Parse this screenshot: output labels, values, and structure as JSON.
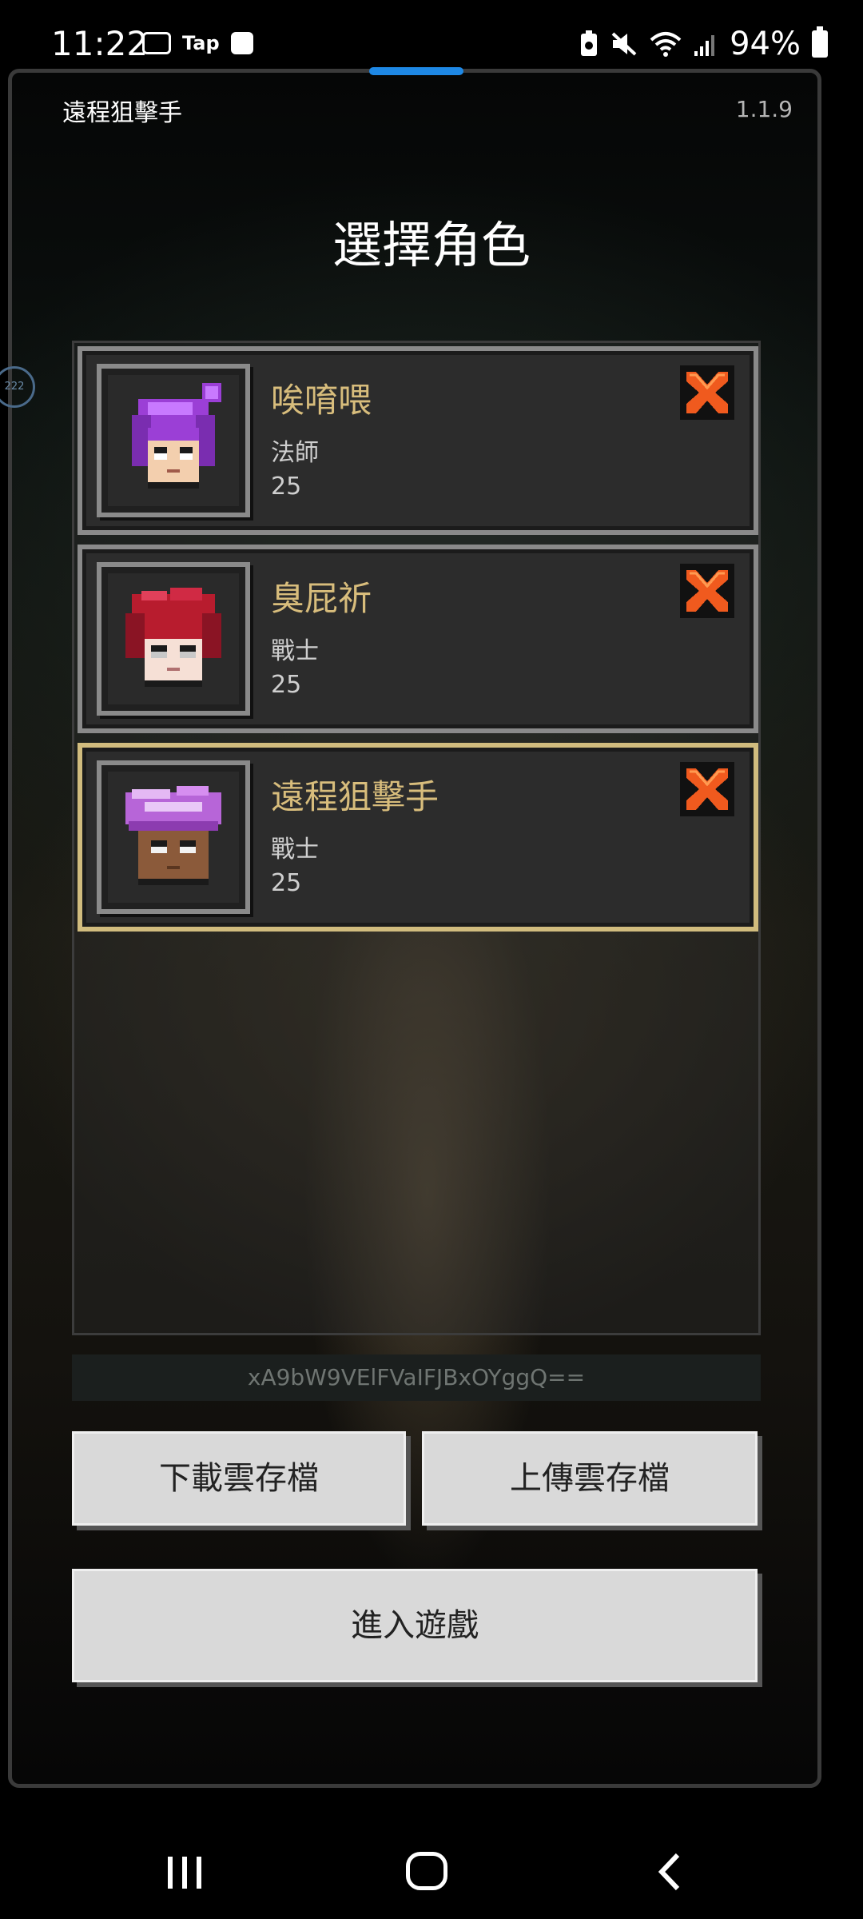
{
  "status_bar": {
    "time": "11:22",
    "left_icons": [
      "camera-icon",
      "tap-icon",
      "clock-icon"
    ],
    "tap_label": "Tap",
    "right_icons": [
      "battery-saver-icon",
      "mute-icon",
      "wifi-icon",
      "signal-icon"
    ],
    "battery_percent": "94%"
  },
  "app": {
    "name": "遠程狙擊手",
    "version": "1.1.9",
    "side_bubble_text": "222"
  },
  "page_title": "選擇角色",
  "characters": [
    {
      "name": "唉唷喂",
      "class": "法師",
      "level": "25",
      "portrait": "purple-hair-mage",
      "selected": false
    },
    {
      "name": "臭屁祈",
      "class": "戰士",
      "level": "25",
      "portrait": "red-hair-warrior",
      "selected": false
    },
    {
      "name": "遠程狙擊手",
      "class": "戰士",
      "level": "25",
      "portrait": "purple-bandana-warrior",
      "selected": true
    }
  ],
  "save_code": "xA9bW9VElFVaIFJBxOYggQ==",
  "buttons": {
    "download": "下載雲存檔",
    "upload": "上傳雲存檔",
    "enter": "進入遊戲"
  },
  "colors": {
    "name_gold": "#d8bd7c",
    "selected_border": "#d1bc7e",
    "delete_orange": "#f05a1e",
    "accent_blue": "#1e88e5"
  }
}
